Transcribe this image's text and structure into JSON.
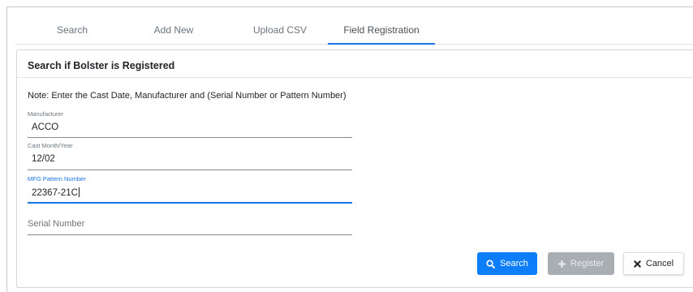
{
  "tabs": [
    {
      "label": "Search"
    },
    {
      "label": "Add New"
    },
    {
      "label": "Upload CSV"
    },
    {
      "label": "Field Registration",
      "active": true
    }
  ],
  "card": {
    "title": "Search if Bolster is Registered",
    "note": "Note: Enter the Cast Date, Manufacturer and (Serial Number or Pattern Number)"
  },
  "fields": {
    "manufacturer": {
      "label": "Manufacturer",
      "value": "ACCO"
    },
    "cast_month_year": {
      "label": "Cast Month/Year",
      "value": "12/02"
    },
    "mfg_pattern_number": {
      "label": "MFG Pattern Number",
      "value": "22367-21C"
    },
    "serial_number": {
      "placeholder": "Serial Number",
      "value": ""
    }
  },
  "buttons": {
    "search": "Search",
    "register": "Register",
    "cancel": "Cancel"
  },
  "colors": {
    "primary": "#0d7ef7",
    "disabled": "#a9aeb3",
    "focus": "#1a73e8"
  },
  "icons": {
    "search": "search-icon",
    "register": "plus-icon",
    "cancel": "close-icon"
  }
}
